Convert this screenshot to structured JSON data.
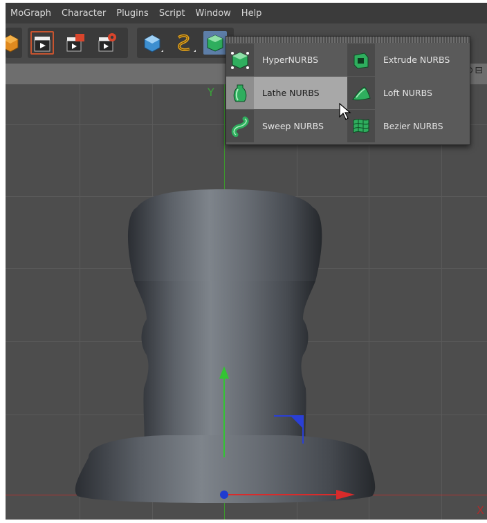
{
  "menubar": {
    "items": [
      "MoGraph",
      "Character",
      "Plugins",
      "Script",
      "Window",
      "Help"
    ]
  },
  "toolbar": {
    "buttons": [
      {
        "icon": "object-cube-icon"
      },
      {
        "icon": "render-active-view-icon"
      },
      {
        "icon": "render-picture-viewer-icon"
      },
      {
        "icon": "render-settings-icon"
      },
      {
        "icon": "primitive-cube-icon"
      },
      {
        "icon": "spline-icon"
      },
      {
        "icon": "nurbs-icon"
      }
    ]
  },
  "viewport": {
    "axis_y_label": "Y",
    "axis_x_label": "X",
    "colors": {
      "grid": "#5a5a5a",
      "y_axis": "#3c9a2c",
      "x_axis": "#b3322f",
      "z_axis": "#2a3fd6"
    }
  },
  "nurbs_menu": {
    "items": [
      {
        "label": "HyperNURBS",
        "icon": "hypernurbs-icon",
        "active": false
      },
      {
        "label": "Extrude NURBS",
        "icon": "extrude-nurbs-icon",
        "active": false
      },
      {
        "label": "Lathe NURBS",
        "icon": "lathe-nurbs-icon",
        "active": true
      },
      {
        "label": "Loft NURBS",
        "icon": "loft-nurbs-icon",
        "active": false
      },
      {
        "label": "Sweep NURBS",
        "icon": "sweep-nurbs-icon",
        "active": false
      },
      {
        "label": "Bezier NURBS",
        "icon": "bezier-nurbs-icon",
        "active": false
      }
    ]
  }
}
